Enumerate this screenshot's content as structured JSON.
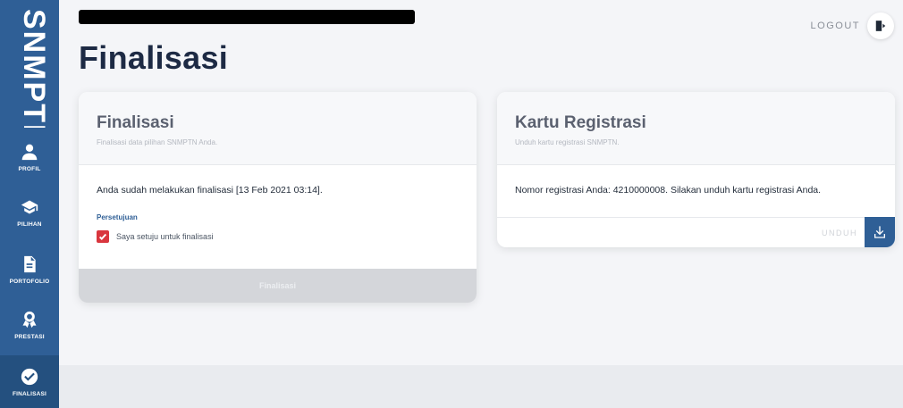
{
  "sidebar": {
    "brand": "SNMPTN",
    "items": [
      {
        "label": "PROFIL",
        "icon": "user-icon"
      },
      {
        "label": "PILIHAN",
        "icon": "graduation-cap-icon"
      },
      {
        "label": "PORTOFOLIO",
        "icon": "document-icon"
      },
      {
        "label": "PRESTASI",
        "icon": "award-icon"
      },
      {
        "label": "FINALISASI",
        "icon": "check-circle-icon",
        "active": true
      }
    ]
  },
  "header": {
    "logout_label": "LOGOUT",
    "page_title": "Finalisasi"
  },
  "finalisasi_card": {
    "title": "Finalisasi",
    "subtitle": "Finalisasi data pilihan SNMPTN Anda.",
    "message": "Anda sudah melakukan finalisasi [13 Feb 2021 03:14].",
    "persetujuan_label": "Persetujuan",
    "checkbox_label": "Saya setuju untuk finalisasi",
    "checkbox_checked": true,
    "button_label": "Finalisasi"
  },
  "kartu_card": {
    "title": "Kartu Registrasi",
    "subtitle": "Unduh kartu registrasi SNMPTN.",
    "message": "Nomor registrasi Anda: 4210000008. Silakan unduh kartu registrasi Anda.",
    "unduh_label": "UNDUH"
  },
  "colors": {
    "sidebar": "#2f5f96",
    "title": "#1d2a44",
    "checkbox": "#d9363e",
    "disabled_button": "#d4d6da"
  }
}
